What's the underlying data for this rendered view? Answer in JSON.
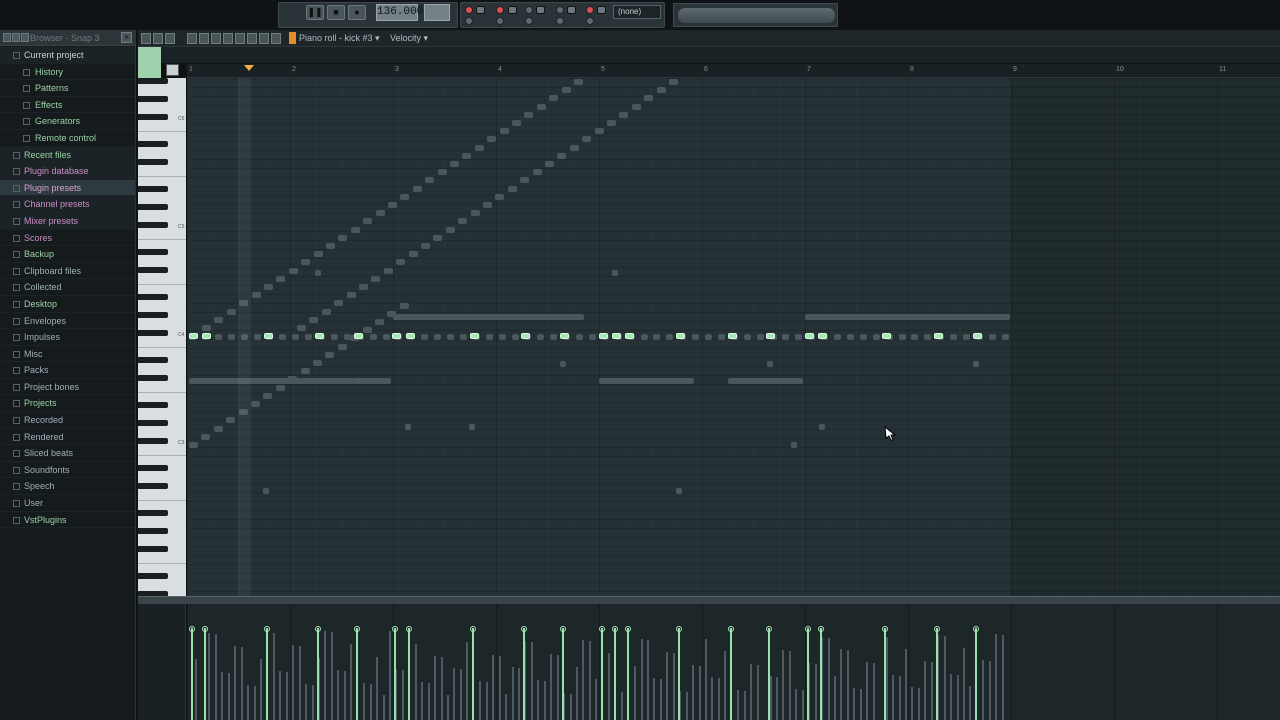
{
  "transport": {
    "tempo": "136.000",
    "snap_label": "(none)"
  },
  "browser": {
    "title": "Browser - Snap 3",
    "close_glyph": "×",
    "items": [
      {
        "label": "Current project",
        "level": "top",
        "group": true,
        "color": "#c6d4d9"
      },
      {
        "label": "History",
        "level": "sub",
        "color": "#9bd3a6"
      },
      {
        "label": "Patterns",
        "level": "sub",
        "color": "#9bd3a6"
      },
      {
        "label": "Effects",
        "level": "sub",
        "color": "#9bd3a6"
      },
      {
        "label": "Generators",
        "level": "sub",
        "color": "#9bd3a6"
      },
      {
        "label": "Remote control",
        "level": "sub",
        "color": "#9bd3a6"
      },
      {
        "label": "Recent files",
        "level": "top",
        "group": true,
        "color": "#9bd3a6"
      },
      {
        "label": "Plugin database",
        "level": "top",
        "group": true,
        "color": "#c98fc6"
      },
      {
        "label": "Plugin presets",
        "level": "top",
        "group": true,
        "selected": true,
        "color": "#d7a3d4"
      },
      {
        "label": "Channel presets",
        "level": "top",
        "group": true,
        "color": "#c98fc6"
      },
      {
        "label": "Mixer presets",
        "level": "top",
        "group": true,
        "color": "#c98fc6"
      },
      {
        "label": "Scores",
        "level": "top",
        "color": "#c98fc6"
      },
      {
        "label": "Backup",
        "level": "top",
        "color": "#9bd3a6"
      },
      {
        "label": "Clipboard files",
        "level": "top",
        "color": "#9fb0b8"
      },
      {
        "label": "Collected",
        "level": "top",
        "color": "#9fb0b8"
      },
      {
        "label": "Desktop",
        "level": "top",
        "color": "#9bd3a6"
      },
      {
        "label": "Envelopes",
        "level": "top",
        "color": "#9fb0b8"
      },
      {
        "label": "Impulses",
        "level": "top",
        "color": "#9fb0b8"
      },
      {
        "label": "Misc",
        "level": "top",
        "color": "#9fb0b8"
      },
      {
        "label": "Packs",
        "level": "top",
        "color": "#9fb0b8"
      },
      {
        "label": "Project bones",
        "level": "top",
        "color": "#9fb0b8"
      },
      {
        "label": "Projects",
        "level": "top",
        "color": "#9bd3a6"
      },
      {
        "label": "Recorded",
        "level": "top",
        "color": "#9fb0b8"
      },
      {
        "label": "Rendered",
        "level": "top",
        "color": "#9fb0b8"
      },
      {
        "label": "Sliced beats",
        "level": "top",
        "color": "#9fb0b8"
      },
      {
        "label": "Soundfonts",
        "level": "top",
        "color": "#9fb0b8"
      },
      {
        "label": "Speech",
        "level": "top",
        "color": "#9fb0b8"
      },
      {
        "label": "User",
        "level": "top",
        "color": "#9fb0b8"
      },
      {
        "label": "VstPlugins",
        "level": "top",
        "color": "#9bd3a6"
      }
    ]
  },
  "piano_roll": {
    "title": "Piano roll - kick #3",
    "title_arrow": "▾",
    "velocity_label": "Velocity",
    "velocity_arrow": "▾",
    "bar_numbers": [
      "1",
      "2",
      "3",
      "4",
      "5",
      "6",
      "7",
      "8",
      "9",
      "10",
      "11"
    ],
    "octave_labels": [
      "C6",
      "C5",
      "C4",
      "C3"
    ]
  }
}
